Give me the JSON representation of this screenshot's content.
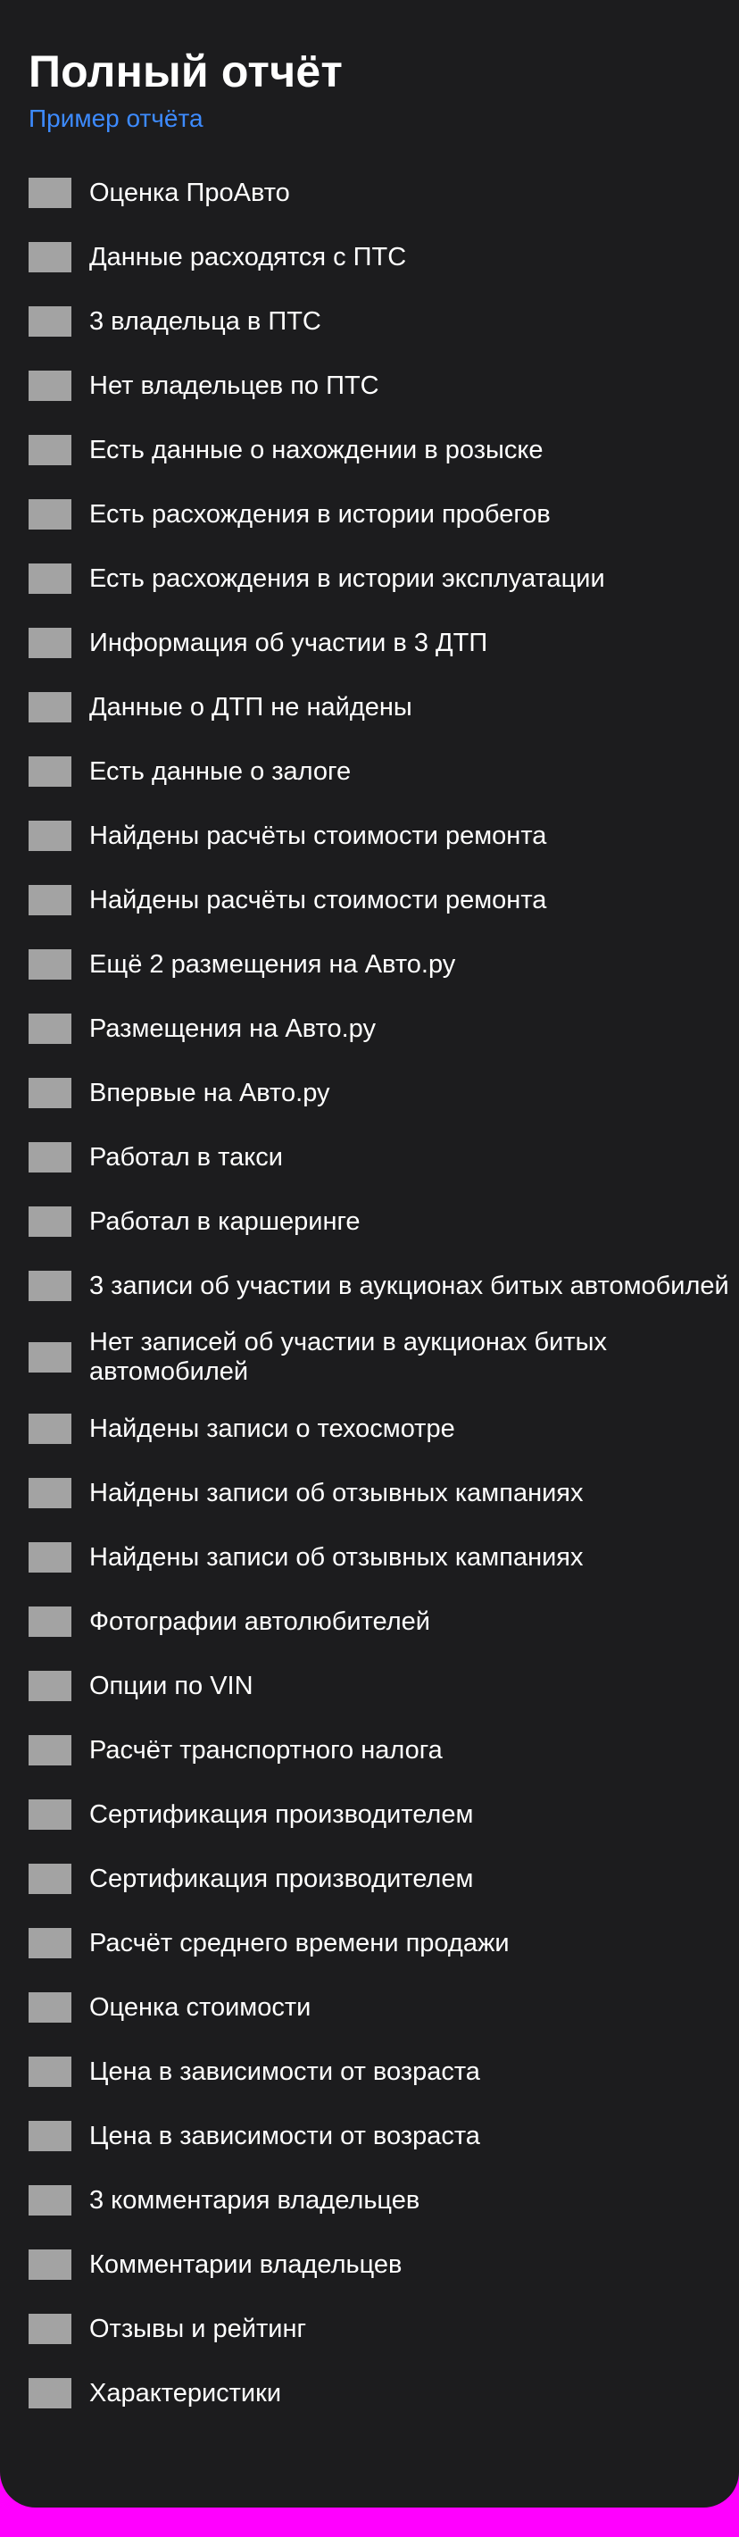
{
  "report": {
    "title": "Полный отчёт",
    "sample_link": "Пример отчёта",
    "items": [
      {
        "label": "Оценка ПроАвто"
      },
      {
        "label": "Данные расходятся с ПТС"
      },
      {
        "label": "3 владельца в ПТС"
      },
      {
        "label": "Нет владельцев по ПТС"
      },
      {
        "label": "Есть данные о нахождении в розыске"
      },
      {
        "label": "Есть расхождения в истории пробегов"
      },
      {
        "label": "Есть расхождения в истории эксплуатации"
      },
      {
        "label": "Информация об участии в 3 ДТП"
      },
      {
        "label": "Данные о ДТП не найдены"
      },
      {
        "label": "Есть данные о залоге"
      },
      {
        "label": "Найдены расчёты стоимости ремонта"
      },
      {
        "label": "Найдены расчёты стоимости ремонта"
      },
      {
        "label": "Ещё 2 размещения на Авто.ру"
      },
      {
        "label": "Размещения на Авто.ру"
      },
      {
        "label": "Впервые на Авто.ру"
      },
      {
        "label": "Работал в такси"
      },
      {
        "label": "Работал в каршеринге"
      },
      {
        "label": "3 записи об участии в аукционах битых автомобилей"
      },
      {
        "label": "Нет записей об участии в аукционах битых автомобилей"
      },
      {
        "label": "Найдены записи о техосмотре"
      },
      {
        "label": "Найдены записи об отзывных кампаниях"
      },
      {
        "label": "Найдены записи об отзывных кампаниях"
      },
      {
        "label": "Фотографии автолюбителей"
      },
      {
        "label": "Опции по VIN"
      },
      {
        "label": "Расчёт транспортного налога"
      },
      {
        "label": "Сертификация производителем"
      },
      {
        "label": "Сертификация производителем"
      },
      {
        "label": "Расчёт среднего времени продажи"
      },
      {
        "label": "Оценка стоимости"
      },
      {
        "label": "Цена в зависимости от возраста"
      },
      {
        "label": "Цена в зависимости от возраста"
      },
      {
        "label": "3 комментария владельцев"
      },
      {
        "label": "Комментарии владельцев"
      },
      {
        "label": "Отзывы и рейтинг"
      },
      {
        "label": "Характеристики"
      }
    ]
  },
  "colors": {
    "card_background": "#1c1c1e",
    "page_background": "#ff00ff",
    "link": "#3d8bff",
    "icon_placeholder": "#a3a3a3",
    "text": "#ffffff"
  }
}
